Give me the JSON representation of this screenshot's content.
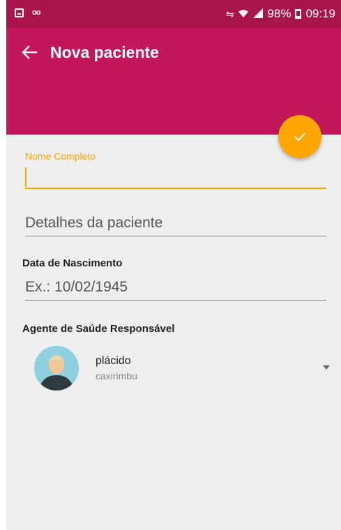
{
  "status_bar": {
    "battery": "98%",
    "time": "09:19",
    "icons": [
      "gallery-icon",
      "voicemail-icon",
      "vibrate-icon",
      "wifi-icon",
      "signal-icon",
      "battery-icon"
    ]
  },
  "app_bar": {
    "title": "Nova paciente",
    "color": "#c2185b",
    "status_color": "#a8154a"
  },
  "fab": {
    "icon": "check-icon",
    "color": "#ffa600"
  },
  "form": {
    "name_field": {
      "label": "Nome Completo",
      "value": ""
    },
    "details_field": {
      "placeholder": "Detalhes da paciente",
      "value": ""
    },
    "birth": {
      "label": "Data de Nascimento",
      "placeholder": "Ex.: 10/02/1945",
      "value": ""
    },
    "agent": {
      "label": "Agente de Saúde Responsável",
      "selected_name": "plácido",
      "selected_location": "caxirimbu"
    }
  },
  "colors": {
    "accent": "#ffa600",
    "background": "#eeeeee"
  }
}
